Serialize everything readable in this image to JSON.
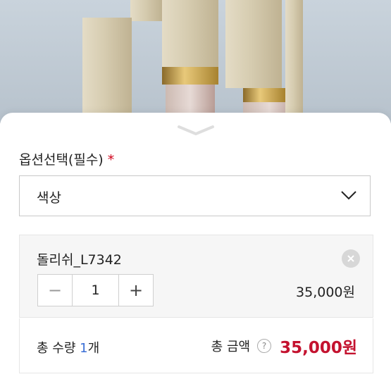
{
  "option_section": {
    "label": "옵션선택(필수)",
    "required_marker": "*",
    "select": {
      "value": "색상"
    }
  },
  "selected_item": {
    "name": "돌리쉬_L7342",
    "quantity": "1",
    "minus_symbol": "−",
    "plus_symbol": "+",
    "price": "35,000원"
  },
  "summary": {
    "count_prefix": "총 수량 ",
    "count_value": "1",
    "count_suffix": "개",
    "total_label": "총 금액",
    "help_symbol": "?",
    "total_amount": "35,000원"
  },
  "colors": {
    "required": "#d0021b",
    "count": "#3b6fd6",
    "total": "#c4122f"
  },
  "icons": [
    "chevron-down-icon",
    "close-icon",
    "help-icon",
    "sheet-handle-icon"
  ]
}
